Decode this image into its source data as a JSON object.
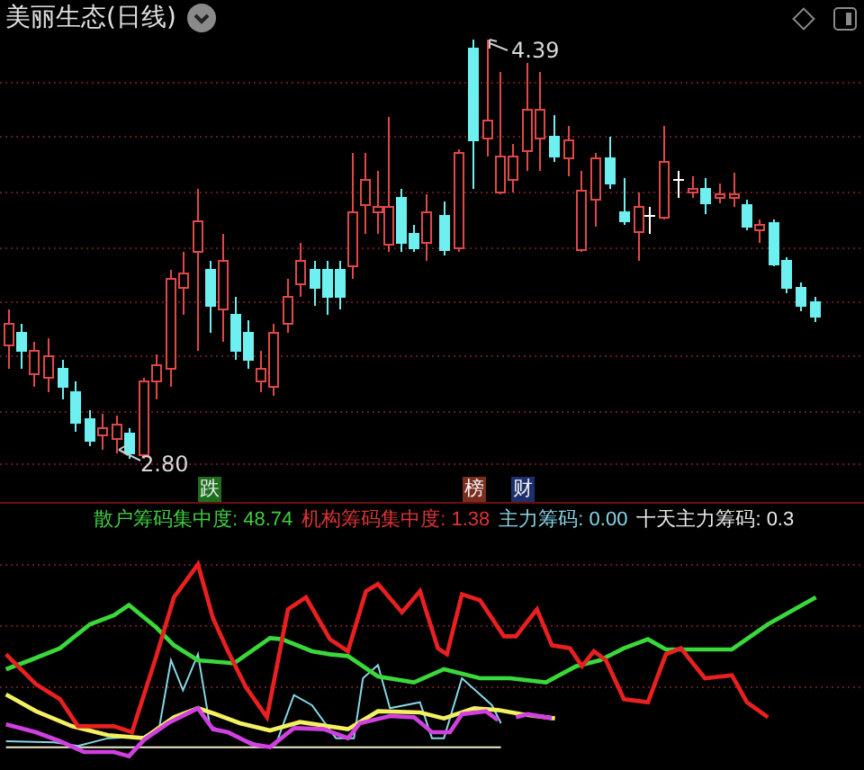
{
  "header": {
    "title": "美丽生态(日线)"
  },
  "price_chart": {
    "high_label": "4.39",
    "low_label": "2.80"
  },
  "tags": [
    {
      "label": "跌",
      "color": "#1f6e1f"
    },
    {
      "label": "榜",
      "color": "#7a2e1e"
    },
    {
      "label": "财",
      "color": "#1e2f6e"
    }
  ],
  "legend": [
    {
      "label": "散户筹码集中度: 48.74",
      "color": "#3fcf3f"
    },
    {
      "label": "机构筹码集中度: 1.38",
      "color": "#e03434"
    },
    {
      "label": "主力筹码: 0.00",
      "color": "#86d6e6"
    },
    {
      "label": "十天主力筹码: 0.3",
      "color": "#ececec"
    }
  ]
}
